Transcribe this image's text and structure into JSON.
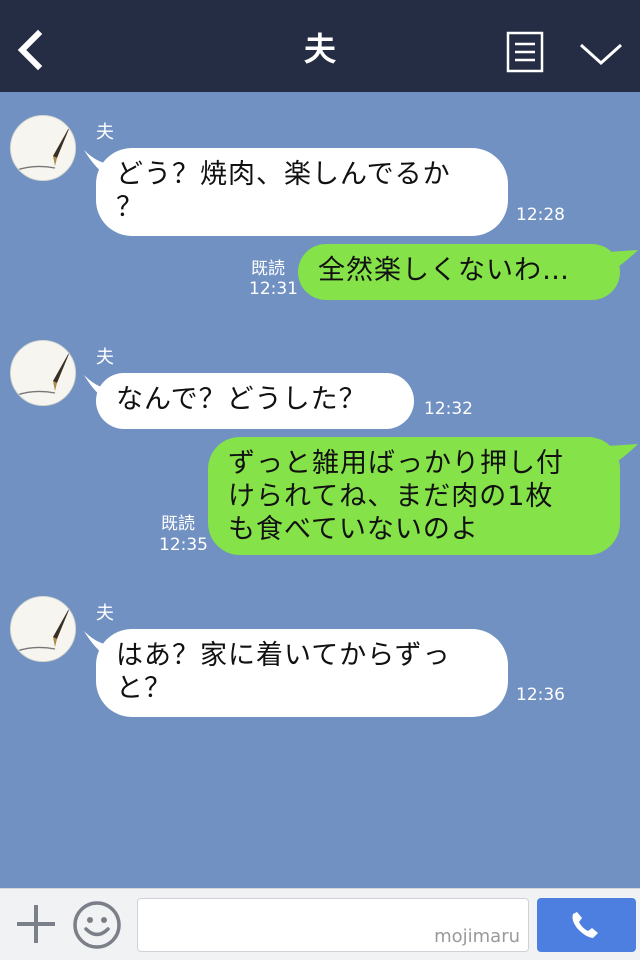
{
  "header": {
    "title": "夫",
    "icons": {
      "back": "chevron-left-icon",
      "menu": "note-list-icon",
      "collapse": "chevron-down-icon"
    }
  },
  "messages": [
    {
      "side": "in",
      "sender": "夫",
      "lines": [
        "どう？焼肉、楽しんでるか",
        "？"
      ],
      "time": "12:28"
    },
    {
      "side": "out",
      "lines": [
        "全然楽しくないわ…"
      ],
      "read": "既読",
      "time": "12:31"
    },
    {
      "side": "in",
      "sender": "夫",
      "lines": [
        "なんで？どうした？"
      ],
      "time": "12:32"
    },
    {
      "side": "out",
      "lines": [
        "ずっと雑用ばっかり押し付",
        "けられてね、まだ肉の1枚",
        "も食べていないのよ"
      ],
      "read": "既読",
      "time": "12:35"
    },
    {
      "side": "in",
      "sender": "夫",
      "lines": [
        "はあ？家に着いてからずっ",
        "と？"
      ],
      "time": "12:36"
    }
  ],
  "input": {
    "value": "",
    "watermark": "mojimaru",
    "icons": {
      "plus": "plus-icon",
      "emoji": "smiley-icon",
      "call": "phone-icon"
    }
  },
  "colors": {
    "header_bg": "#252d44",
    "chat_bg": "#7191c2",
    "outgoing_bubble": "#85e249",
    "incoming_bubble": "#ffffff",
    "call_button": "#4c7fe0"
  }
}
